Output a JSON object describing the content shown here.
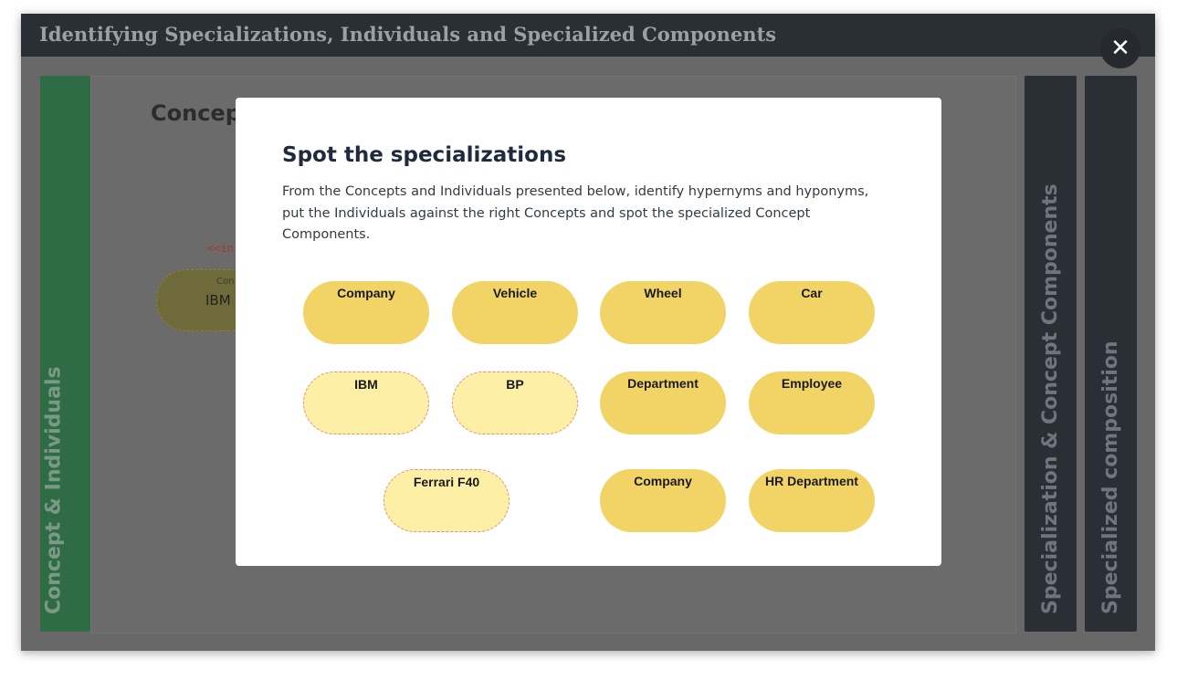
{
  "window": {
    "title": "Identifying Specializations, Individuals and Specialized Components",
    "close_symbol": "✕"
  },
  "tabs": {
    "left": "Concept & Individuals",
    "right_1": "Specialization & Concept Components",
    "right_2": "Specialized composition"
  },
  "background": {
    "heading": "Concep",
    "stereotype": "<<in",
    "pill_type": "Con",
    "pill_name": "IBM"
  },
  "modal": {
    "title": "Spot the specializations",
    "description": "From the Concepts and Individuals presented below, identify hypernyms and hyponyms, put the Individuals against the right Concepts and spot the specialized Concept Components.",
    "items": [
      {
        "label": "Company",
        "kind": "concept"
      },
      {
        "label": "Vehicle",
        "kind": "concept"
      },
      {
        "label": "Wheel",
        "kind": "concept"
      },
      {
        "label": "Car",
        "kind": "concept"
      },
      {
        "label": "IBM",
        "kind": "individual"
      },
      {
        "label": "BP",
        "kind": "individual"
      },
      {
        "label": "Department",
        "kind": "concept"
      },
      {
        "label": "Employee",
        "kind": "concept"
      },
      {
        "label": "Ferrari F40",
        "kind": "individual"
      },
      {
        "label": "Company",
        "kind": "concept"
      },
      {
        "label": "HR Department",
        "kind": "concept"
      }
    ]
  },
  "colors": {
    "concept_fill": "#f2d466",
    "individual_fill": "#fdf0a6",
    "individual_border": "#e28f7c",
    "left_tab": "#2f6b45",
    "dark_tab": "#2a2f36"
  }
}
